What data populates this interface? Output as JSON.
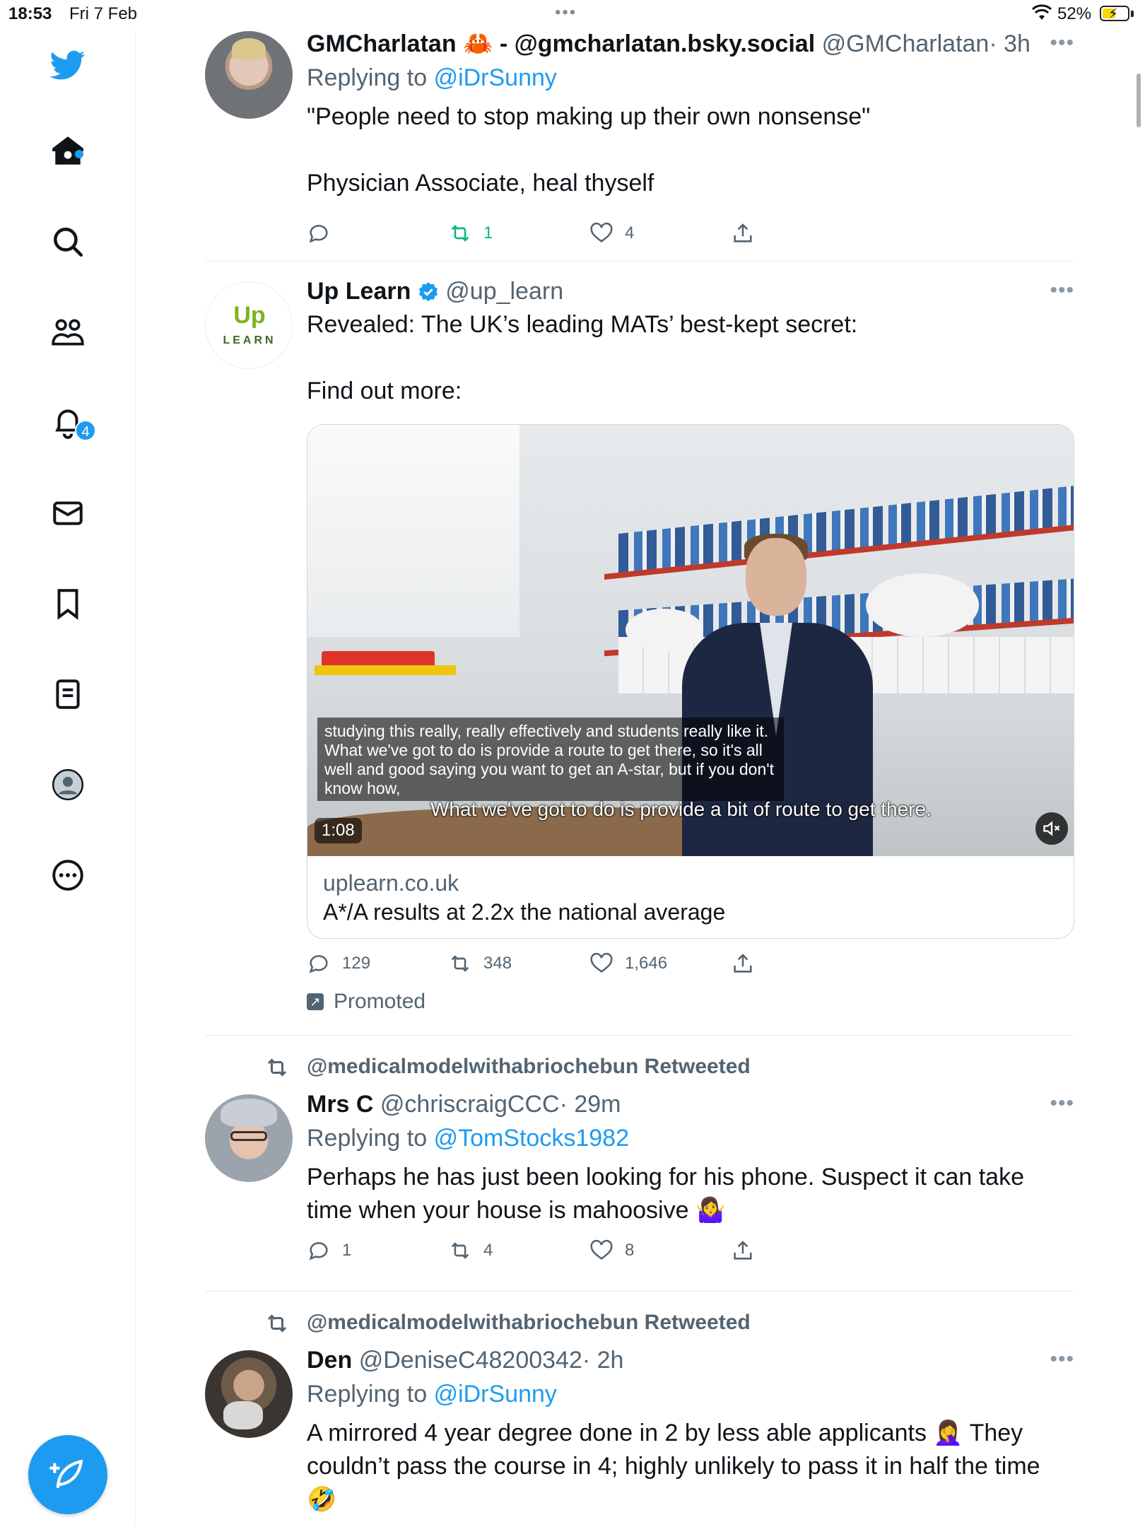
{
  "status_bar": {
    "time": "18:53",
    "date": "Fri 7 Feb",
    "battery": "52%",
    "battery_level": 0.52
  },
  "sidebar": {
    "items": [
      {
        "icon": "twitter-bird-icon"
      },
      {
        "icon": "home-icon",
        "has_dot": true
      },
      {
        "icon": "search-icon"
      },
      {
        "icon": "communities-icon"
      },
      {
        "icon": "bell-icon",
        "badge": "4"
      },
      {
        "icon": "mail-icon"
      },
      {
        "icon": "bookmark-icon"
      },
      {
        "icon": "lists-icon"
      },
      {
        "icon": "profile-icon"
      },
      {
        "icon": "more-circle-icon"
      }
    ],
    "compose_icon": "compose-feather-icon",
    "accent": "#1d9bf0"
  },
  "tweets": [
    {
      "name": "GMCharlatan 🦀 - @gmcharlatan.bsky.social",
      "handle": "@GMCharlatan",
      "time": "· 3h",
      "replying_prefix": "Replying to",
      "replying_to": "@iDrSunny",
      "text": "\"People need to stop making up their own nonsense\"\n\nPhysician Associate, heal thyself",
      "replies": "",
      "retweets": "1",
      "likes": "4"
    },
    {
      "name": "Up Learn",
      "verified": true,
      "handle": "@up_learn",
      "avatar_logo": {
        "top": "Up",
        "bottom": "LEARN"
      },
      "text": "Revealed: The UK’s leading MATs’ best-kept secret:\n\nFind out more:",
      "video": {
        "subtitle": "studying this really, really effectively and students really like it. What we've got to do is provide a route to get there, so it's all well and good saying you want to get an A-star, but if you don't know how,",
        "burned_caption": "What we've got to do is provide a bit of route to get there.",
        "duration": "1:08"
      },
      "card_domain": "uplearn.co.uk",
      "card_title": "A*/A results at 2.2x the national average",
      "replies": "129",
      "retweets": "348",
      "likes": "1,646",
      "promoted": "Promoted"
    },
    {
      "retweeted_by": "@medicalmodelwithabriochebun Retweeted",
      "name": "Mrs C",
      "handle": "@chriscraigCCC",
      "time": "· 29m",
      "replying_prefix": "Replying to",
      "replying_to": "@TomStocks1982",
      "text": "Perhaps he has just been looking for his phone. Suspect it can take time when your house is mahoosive 🤷‍♀️",
      "replies": "1",
      "retweets": "4",
      "likes": "8"
    },
    {
      "retweeted_by": "@medicalmodelwithabriochebun Retweeted",
      "name": "Den",
      "handle": "@DeniseC48200342",
      "time": "· 2h",
      "replying_prefix": "Replying to",
      "replying_to": "@iDrSunny",
      "text": "A mirrored 4 year degree done in 2 by less able applicants 🤦‍♀️ They couldn’t pass the course in 4; highly unlikely to pass it in half the time 🤣"
    }
  ]
}
